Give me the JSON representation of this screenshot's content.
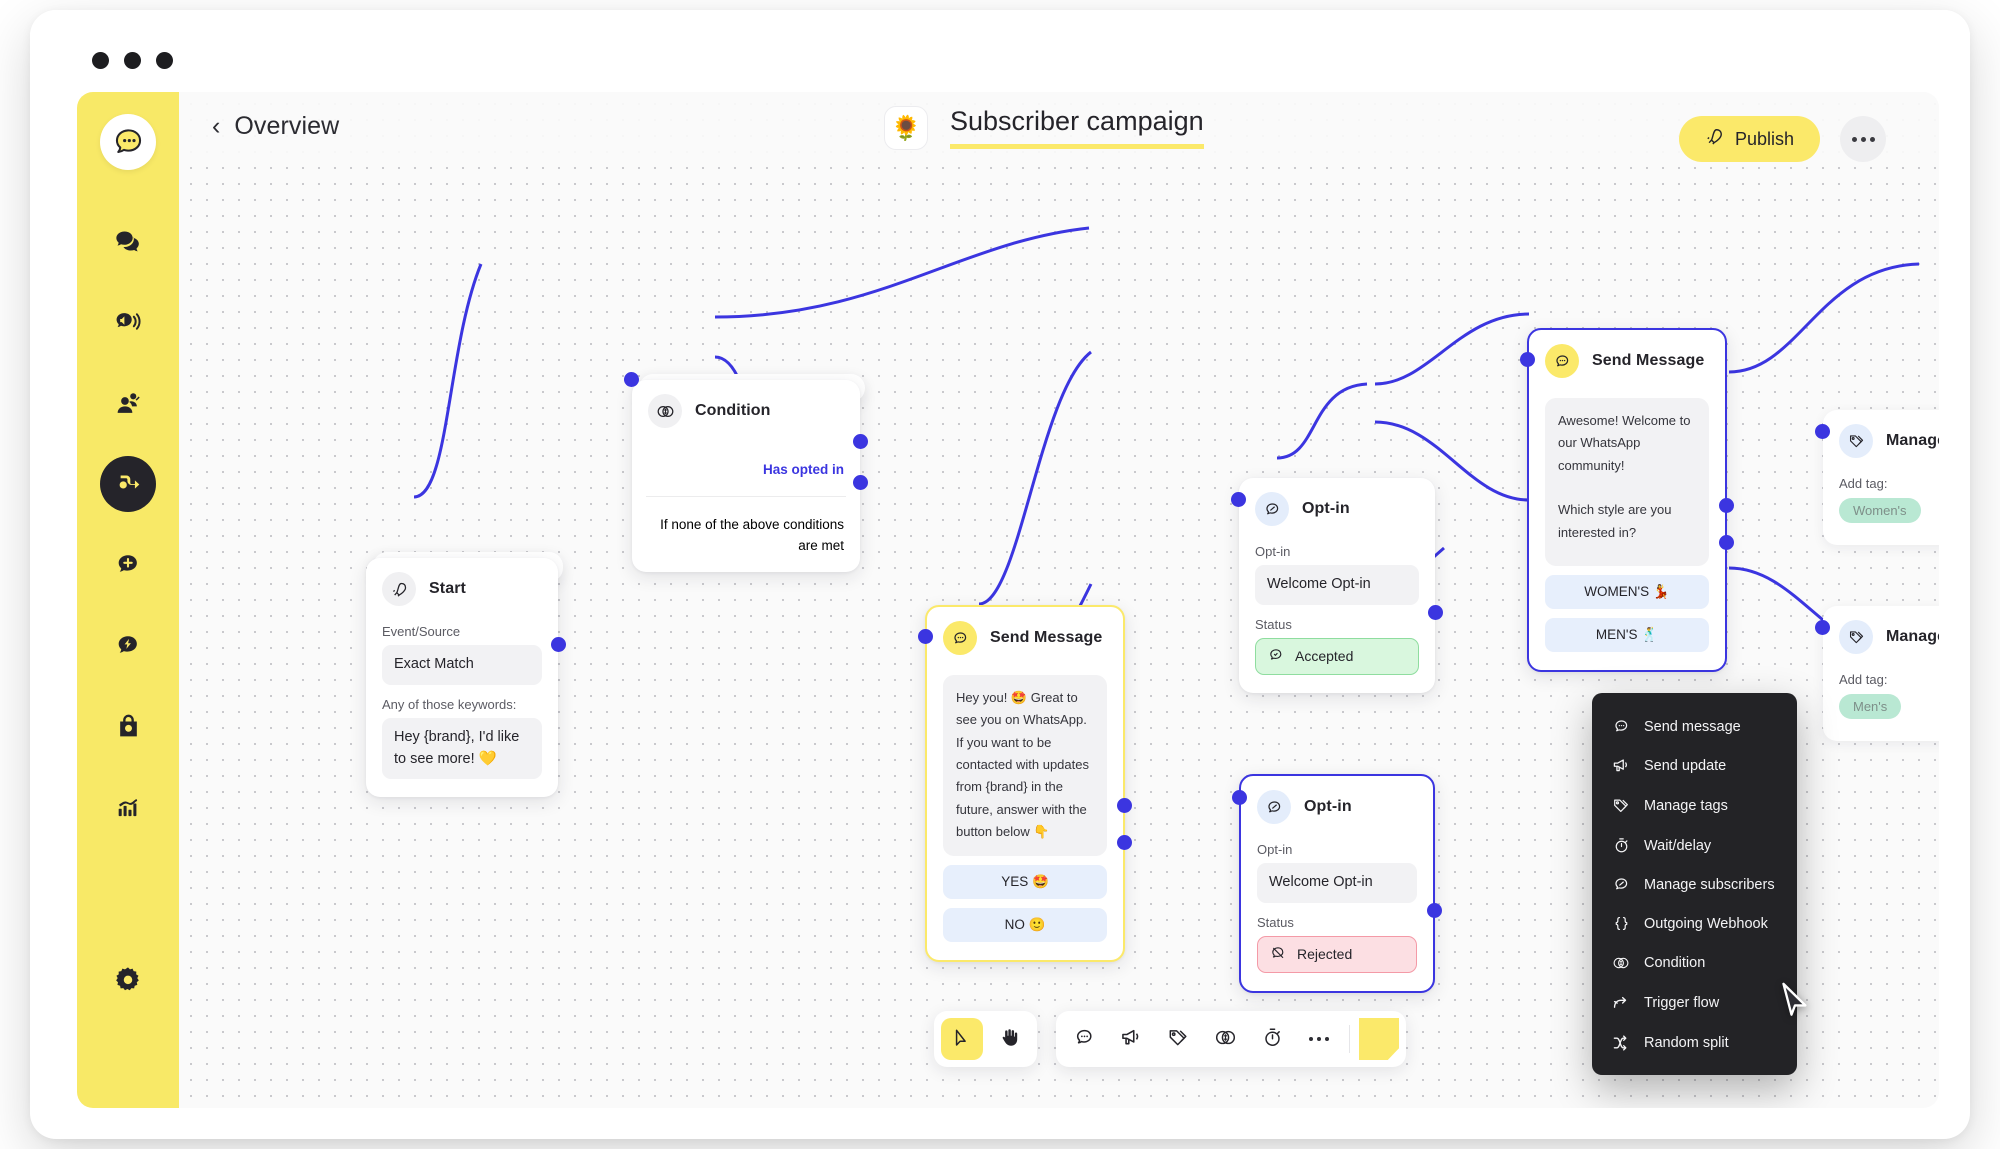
{
  "window": {
    "traffic_lights": [
      "close",
      "minimize",
      "maximize"
    ]
  },
  "sidebar": {
    "logo_icon": "chat-bubble-logo-icon",
    "items": [
      {
        "icon": "chats-icon",
        "name": "chats",
        "active": false
      },
      {
        "icon": "broadcast-icon",
        "name": "broadcasts",
        "active": false
      },
      {
        "icon": "audience-icon",
        "name": "audience",
        "active": false
      },
      {
        "icon": "flows-icon",
        "name": "flows",
        "active": true
      },
      {
        "icon": "add-message-icon",
        "name": "new-message",
        "active": false
      },
      {
        "icon": "automation-bolt-icon",
        "name": "automation",
        "active": false
      },
      {
        "icon": "shop-bag-icon",
        "name": "commerce",
        "active": false
      },
      {
        "icon": "analytics-chart-icon",
        "name": "analytics",
        "active": false
      },
      {
        "icon": "gear-icon",
        "name": "settings",
        "active": false
      }
    ]
  },
  "topbar": {
    "back_label": "Overview",
    "back_icon": "chevron-left-icon",
    "flow_emoji": "🌻",
    "flow_title": "Subscriber campaign",
    "publish_label": "Publish",
    "publish_icon": "rocket-icon",
    "more_icon": "ellipsis-icon",
    "accent_color": "#fbe96a"
  },
  "nodes": {
    "start": {
      "title": "Start",
      "icon": "rocket-icon",
      "field1_label": "Event/Source",
      "field1_value": "Exact Match",
      "field2_label": "Any of those keywords:",
      "field2_value": "Hey {brand}, I'd like to see more! 💛"
    },
    "condition": {
      "title": "Condition",
      "icon": "condition-venn-icon",
      "branch_true": "Has opted in",
      "branch_else": "If none of the above conditions are met",
      "branch_true_color": "#3b35e0"
    },
    "send_message_1": {
      "title": "Send Message",
      "icon": "message-bubble-icon",
      "body": "Hey you! 🤩 Great to see you on WhatsApp. If you want to be contacted with updates from {brand} in the future, answer with the button below 👇",
      "buttons": [
        "YES 🤩",
        "NO 🙂"
      ]
    },
    "optin_accepted": {
      "title": "Opt-in",
      "icon": "optin-bubble-icon",
      "field_label": "Opt-in",
      "field_value": "Welcome Opt-in",
      "status_label": "Status",
      "status_value": "Accepted",
      "status_icon": "check-bubble-icon",
      "status_color": "#d9f7de"
    },
    "optin_rejected": {
      "title": "Opt-in",
      "icon": "optin-bubble-icon",
      "field_label": "Opt-in",
      "field_value": "Welcome Opt-in",
      "status_label": "Status",
      "status_value": "Rejected",
      "status_icon": "muted-bubble-icon",
      "status_color": "#fcdfe3"
    },
    "send_message_2": {
      "title": "Send Message",
      "icon": "message-bubble-icon",
      "body_line1": "Awesome! Welcome to our WhatsApp community!",
      "body_line2": "Which style are you interested in?",
      "buttons": [
        "WOMEN'S 💃",
        "MEN'S 🕺"
      ]
    },
    "manage_tags_womens": {
      "title": "Manage tags",
      "icon": "tag-icon",
      "field_label": "Add tag:",
      "tag": "Women's"
    },
    "manage_tags_mens": {
      "title": "Manage tags",
      "icon": "tag-icon",
      "field_label": "Add tag:",
      "tag": "Men's"
    }
  },
  "context_menu": {
    "items": [
      {
        "label": "Send message",
        "icon": "message-bubble-icon"
      },
      {
        "label": "Send update",
        "icon": "megaphone-icon"
      },
      {
        "label": "Manage tags",
        "icon": "tag-icon"
      },
      {
        "label": "Wait/delay",
        "icon": "timer-icon"
      },
      {
        "label": "Manage subscribers",
        "icon": "optin-bubble-icon"
      },
      {
        "label": "Outgoing Webhook",
        "icon": "braces-icon"
      },
      {
        "label": "Condition",
        "icon": "condition-venn-icon"
      },
      {
        "label": "Trigger flow",
        "icon": "arrow-branch-icon"
      },
      {
        "label": "Random split",
        "icon": "shuffle-icon"
      }
    ]
  },
  "toolbar": {
    "left_group": [
      {
        "icon": "cursor-arrow-icon",
        "name": "select-tool",
        "active": true
      },
      {
        "icon": "hand-icon",
        "name": "pan-tool",
        "active": false
      }
    ],
    "right_group": [
      {
        "icon": "message-bubble-icon",
        "name": "add-message-node"
      },
      {
        "icon": "megaphone-icon",
        "name": "add-update-node"
      },
      {
        "icon": "tag-icon",
        "name": "add-tag-node"
      },
      {
        "icon": "condition-venn-icon",
        "name": "add-condition-node"
      },
      {
        "icon": "timer-icon",
        "name": "add-delay-node"
      },
      {
        "icon": "ellipsis-icon",
        "name": "more-nodes"
      }
    ],
    "sticky_note": "sticky-note-icon"
  },
  "cursor": {
    "icon": "mouse-pointer-icon"
  }
}
